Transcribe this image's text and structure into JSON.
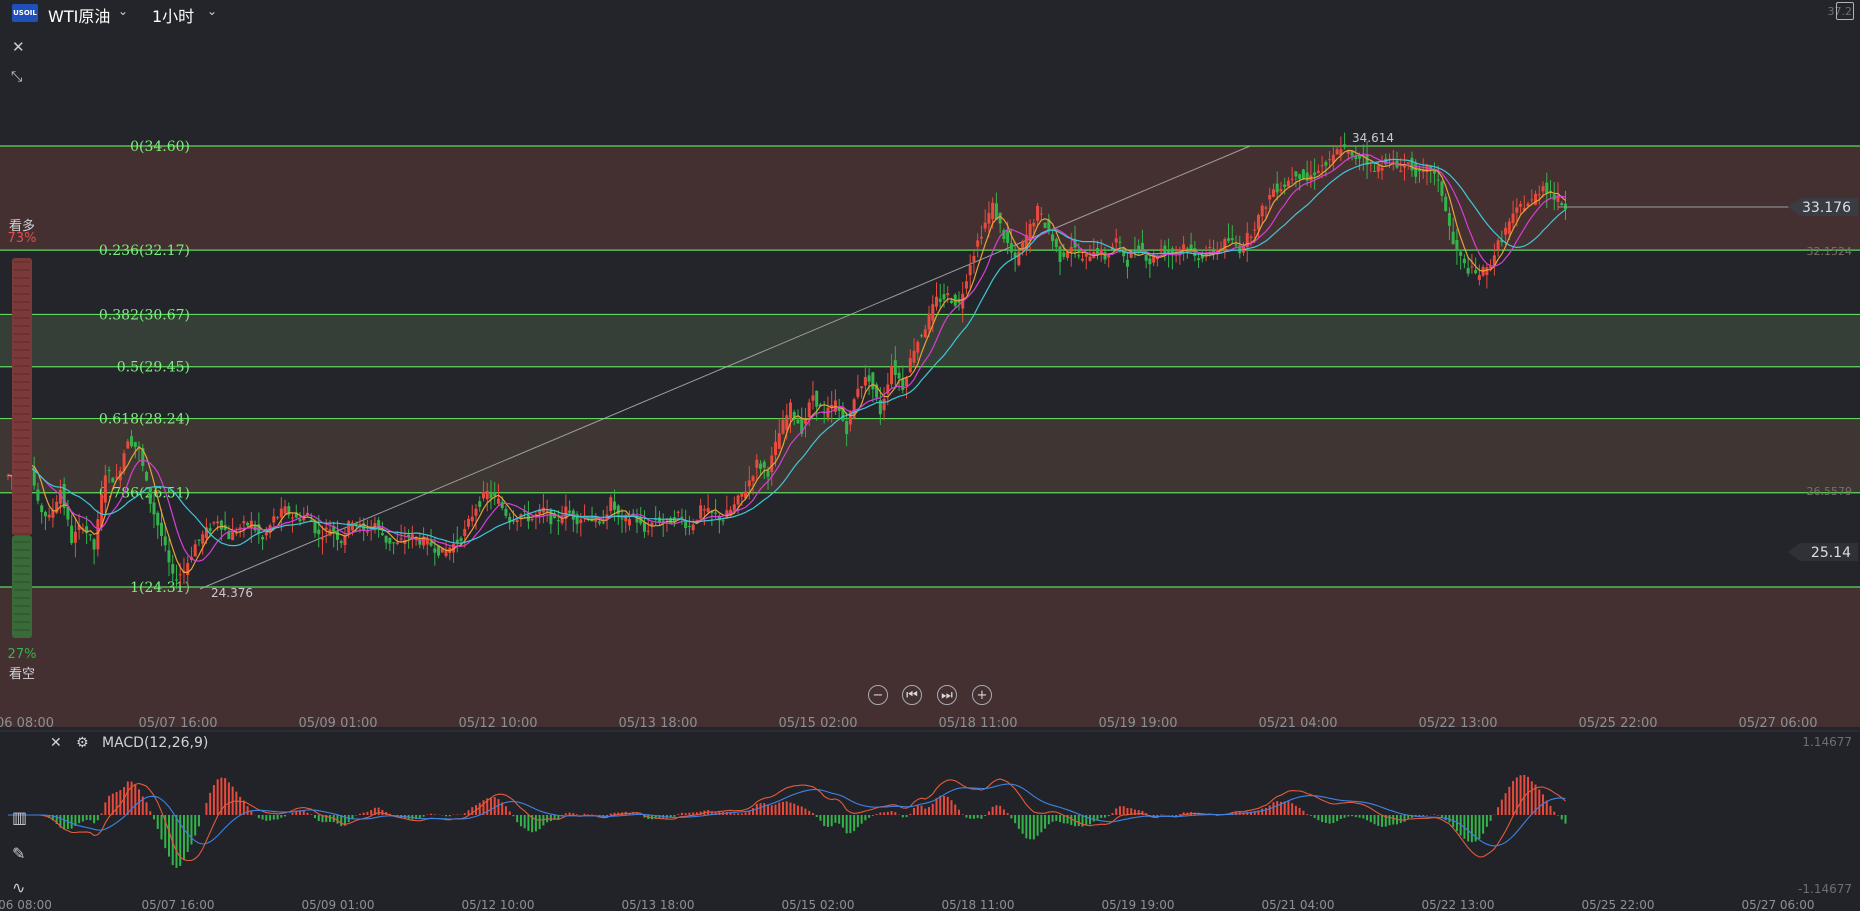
{
  "toolbar": {
    "logo_text": "USOIL",
    "symbol": "WTI原油",
    "interval": "1小时",
    "close_icon": "close-icon",
    "collapse_icon": "collapse-icon"
  },
  "sentiment": {
    "bull_label": "看多",
    "bull_pct": "73%",
    "bear_label": "看空",
    "bear_pct": "27%",
    "bull_fraction": 0.73
  },
  "price_labels": {
    "top_scale": "37.2",
    "current": "33.176",
    "ma_value": "32.1524",
    "lower_ref": "26.5579",
    "box": "25.14",
    "high": "34.614",
    "low": "24.376"
  },
  "macd": {
    "label": "MACD(12,26,9)",
    "top": "1.14677",
    "bottom": "-1.14677"
  },
  "chart_data": {
    "type": "candlestick",
    "fibonacci": [
      {
        "label": "0(34.60)",
        "value": 34.6
      },
      {
        "label": "0.236(32.17)",
        "value": 32.17
      },
      {
        "label": "0.382(30.67)",
        "value": 30.67
      },
      {
        "label": "0.5(29.45)",
        "value": 29.45
      },
      {
        "label": "0.618(28.24)",
        "value": 28.24
      },
      {
        "label": "0.786(26.51)",
        "value": 26.51
      },
      {
        "label": "1(24.31)",
        "value": 24.31
      }
    ],
    "x_ticks": [
      "06 08:00",
      "05/07 16:00",
      "05/09 01:00",
      "05/12 10:00",
      "05/13 18:00",
      "05/15 02:00",
      "05/18 11:00",
      "05/19 19:00",
      "05/21 04:00",
      "05/22 13:00",
      "05/25 22:00",
      "05/27 06:00"
    ],
    "price_path": [
      26.9,
      27.6,
      26.2,
      25.9,
      26.6,
      25.4,
      25.8,
      25.2,
      27.0,
      26.8,
      27.8,
      27.5,
      26.3,
      25.5,
      24.5,
      24.7,
      25.3,
      25.6,
      25.9,
      25.5,
      25.7,
      25.8,
      25.4,
      25.9,
      26.1,
      25.9,
      26.0,
      25.5,
      25.7,
      25.4,
      25.9,
      25.6,
      25.8,
      25.4,
      25.3,
      25.5,
      25.4,
      25.3,
      25.1,
      25.3,
      25.6,
      26.2,
      26.5,
      26.3,
      25.9,
      26.0,
      25.9,
      26.1,
      25.8,
      26.1,
      25.9,
      26.0,
      25.7,
      26.3,
      25.8,
      26.0,
      25.6,
      25.9,
      25.8,
      26.0,
      25.7,
      26.1,
      26.0,
      25.9,
      26.2,
      26.6,
      27.2,
      27.0,
      27.9,
      28.5,
      28.0,
      28.8,
      28.3,
      28.6,
      28.0,
      29.0,
      29.2,
      28.4,
      29.5,
      29.0,
      29.9,
      30.4,
      31.0,
      31.1,
      30.9,
      31.9,
      32.6,
      33.2,
      32.5,
      31.9,
      32.5,
      33.1,
      32.6,
      32.0,
      32.3,
      31.9,
      32.2,
      32.0,
      32.4,
      31.9,
      32.3,
      31.9,
      32.2,
      32.1,
      32.3,
      32.0,
      32.1,
      32.2,
      32.4,
      32.2,
      32.6,
      33.1,
      33.6,
      33.7,
      34.0,
      33.8,
      34.1,
      34.2,
      34.6,
      34.3,
      34.4,
      34.0,
      34.3,
      34.1,
      34.2,
      33.9,
      34.1,
      33.5,
      32.3,
      31.8,
      31.6,
      31.7,
      32.3,
      32.8,
      33.2,
      33.3,
      33.7,
      33.4,
      33.2
    ]
  }
}
